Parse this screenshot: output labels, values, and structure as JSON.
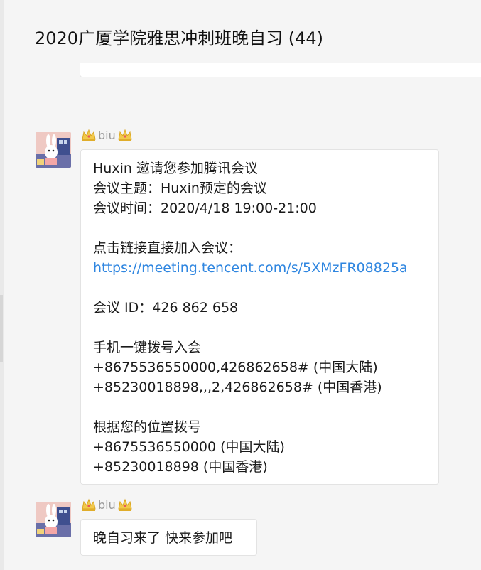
{
  "header": {
    "title": "2020广厦学院雅思冲刺班晚自习 (44)"
  },
  "messages": [
    {
      "sender": "biu",
      "lines": [
        "Huxin 邀请您参加腾讯会议",
        "会议主题：Huxin预定的会议",
        "会议时间：2020/4/18 19:00-21:00",
        "",
        "点击链接直接加入会议：",
        "https://meeting.tencent.com/s/5XMzFR08825a",
        "",
        "会议 ID：426 862 658",
        "",
        "手机一键拨号入会",
        "+8675536550000,426862658# (中国大陆)",
        "+85230018898,,,2,426862658# (中国香港)",
        "",
        "根据您的位置拨号",
        "+8675536550000 (中国大陆)",
        "+85230018898 (中国香港)"
      ]
    },
    {
      "sender": "biu",
      "lines": [
        "晚自习来了 快来参加吧"
      ]
    }
  ],
  "icons": {
    "crown": "crown-icon",
    "avatar": "avatar-cartoon"
  },
  "colors": {
    "link": "#2f86e0",
    "background": "#f5f5f5",
    "bubble": "#ffffff",
    "sender": "#9a9a9a"
  }
}
